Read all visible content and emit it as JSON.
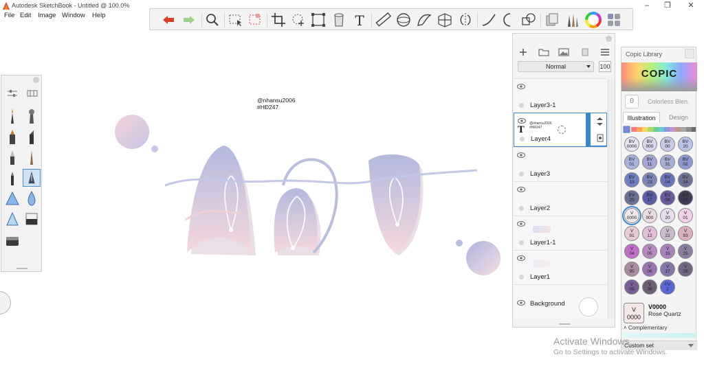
{
  "window": {
    "title": "Autodesk SketchBook - Untitled @ 100.0%",
    "menu": [
      "File",
      "Edit",
      "Image",
      "Window",
      "Help"
    ]
  },
  "toolbar": {
    "tools": [
      "undo-icon",
      "redo-icon",
      "zoom-icon",
      "selection-icon",
      "selection-alt-icon",
      "crop-icon",
      "lasso-icon",
      "transform-icon",
      "bucket-icon",
      "text-icon",
      "ruler-icon",
      "ellipse-guide-icon",
      "french-curve-icon",
      "perspective-icon",
      "symmetry-icon",
      "stroke-icon",
      "shape-icon",
      "layer-transform-icon",
      "copic-icon",
      "brush-library-icon",
      "color-wheel-icon",
      "palette-icon"
    ]
  },
  "canvas": {
    "watermark_line1": "@nhansu2006",
    "watermark_line2": "#HĐ247",
    "colors": {
      "lavender": "#b9bedf",
      "pink": "#f3d6dc"
    }
  },
  "layers": {
    "blend_mode": "Normal",
    "opacity": "100",
    "items": [
      {
        "name": "Layer3-1",
        "selected": false
      },
      {
        "name": "Layer4",
        "selected": true,
        "thumb_line1": "@nhansu2006",
        "thumb_line2": "#HĐ247"
      },
      {
        "name": "Layer3",
        "selected": false
      },
      {
        "name": "Layer2",
        "selected": false
      },
      {
        "name": "Layer1-1",
        "selected": false
      },
      {
        "name": "Layer1",
        "selected": false
      },
      {
        "name": "Background",
        "selected": false
      }
    ]
  },
  "copic": {
    "title": "Copic Library",
    "logo": "COPIC",
    "colorless_swatch": "0",
    "colorless_label": "Colorless Blen.",
    "tabs": [
      "Illustration",
      "Design"
    ],
    "swatches": [
      {
        "l1": "BV",
        "l2": "0000",
        "c": "#e8e6f4"
      },
      {
        "l1": "BV",
        "l2": "000",
        "c": "#d7d6ef"
      },
      {
        "l1": "BV",
        "l2": "00",
        "c": "#c9cae8"
      },
      {
        "l1": "BV",
        "l2": "20",
        "c": "#b8c3e6"
      },
      {
        "l1": "BV",
        "l2": "01",
        "c": "#a9b1dd"
      },
      {
        "l1": "BV",
        "l2": "11",
        "c": "#a3a6d6"
      },
      {
        "l1": "BV",
        "l2": "31",
        "c": "#a8aed4"
      },
      {
        "l1": "BV",
        "l2": "02",
        "c": "#8e96cf"
      },
      {
        "l1": "BV",
        "l2": "13",
        "c": "#6e7fc4"
      },
      {
        "l1": "BV",
        "l2": "23",
        "c": "#7d86b8"
      },
      {
        "l1": "BV",
        "l2": "04",
        "c": "#6b75bd"
      },
      {
        "l1": "BV",
        "l2": "34",
        "c": "#6e7394"
      },
      {
        "l1": "BV",
        "l2": "25",
        "c": "#6a6f93"
      },
      {
        "l1": "BV",
        "l2": "17",
        "c": "#5a5ea6"
      },
      {
        "l1": "BV",
        "l2": "08",
        "c": "#6a5aa0"
      },
      {
        "l1": "BV",
        "l2": "29",
        "c": "#3e3d55"
      },
      {
        "l1": "V",
        "l2": "0000",
        "c": "#f0e7ea",
        "sel": true
      },
      {
        "l1": "V",
        "l2": "000",
        "c": "#eadbe2"
      },
      {
        "l1": "V",
        "l2": "20",
        "c": "#e6dcec"
      },
      {
        "l1": "V",
        "l2": "01",
        "c": "#efd0e7"
      },
      {
        "l1": "V",
        "l2": "91",
        "c": "#e9ccd3"
      },
      {
        "l1": "V",
        "l2": "12",
        "c": "#e2bfd8"
      },
      {
        "l1": "V",
        "l2": "22",
        "c": "#c8bccc"
      },
      {
        "l1": "V",
        "l2": "93",
        "c": "#dbaec0"
      },
      {
        "l1": "V",
        "l2": "04",
        "c": "#c06fc6"
      },
      {
        "l1": "V",
        "l2": "05",
        "c": "#b889c0"
      },
      {
        "l1": "V",
        "l2": "15",
        "c": "#a983bb"
      },
      {
        "l1": "V",
        "l2": "25",
        "c": "#8a7da0"
      },
      {
        "l1": "V",
        "l2": "95",
        "c": "#a98ca2"
      },
      {
        "l1": "V",
        "l2": "06",
        "c": "#9d74b2"
      },
      {
        "l1": "V",
        "l2": "17",
        "c": "#8676a8"
      },
      {
        "l1": "V",
        "l2": "28",
        "c": "#6f6781"
      },
      {
        "l1": "V",
        "l2": "09",
        "c": "#7a5e94"
      },
      {
        "l1": "V",
        "l2": "99",
        "c": "#6d5e74"
      },
      {
        "l1": "FV",
        "l2": "2",
        "c": "#5b66d6"
      }
    ],
    "current": {
      "l1": "V",
      "l2": "0000",
      "code": "V0000",
      "name": "Rose Quartz"
    },
    "complementary": "Complementary",
    "custom_set": "Custom set"
  },
  "activation": {
    "line1": "Activate Windows",
    "line2": "Go to Settings to activate Windows."
  }
}
